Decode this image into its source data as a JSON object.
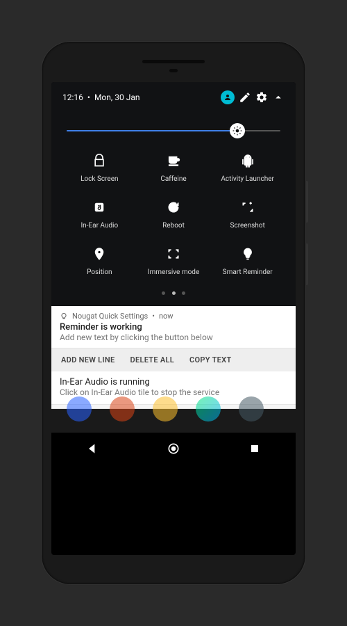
{
  "status": {
    "time": "12:16",
    "date": "Mon, 30 Jan"
  },
  "brightness": {
    "percent": 80
  },
  "tiles": [
    {
      "label": "Lock Screen"
    },
    {
      "label": "Caffeine"
    },
    {
      "label": "Activity Launcher"
    },
    {
      "label": "In-Ear Audio"
    },
    {
      "label": "Reboot"
    },
    {
      "label": "Screenshot"
    },
    {
      "label": "Position"
    },
    {
      "label": "Immersive mode"
    },
    {
      "label": "Smart Reminder"
    }
  ],
  "pager": {
    "count": 3,
    "active": 1
  },
  "notification1": {
    "app": "Nougat Quick Settings",
    "when": "now",
    "title": "Reminder is working",
    "body": "Add new text by clicking the button below",
    "actions": [
      "ADD NEW LINE",
      "DELETE ALL",
      "COPY TEXT"
    ]
  },
  "notification2": {
    "title": "In-Ear Audio is running",
    "body": "Click on In-Ear Audio tile to stop the service"
  }
}
